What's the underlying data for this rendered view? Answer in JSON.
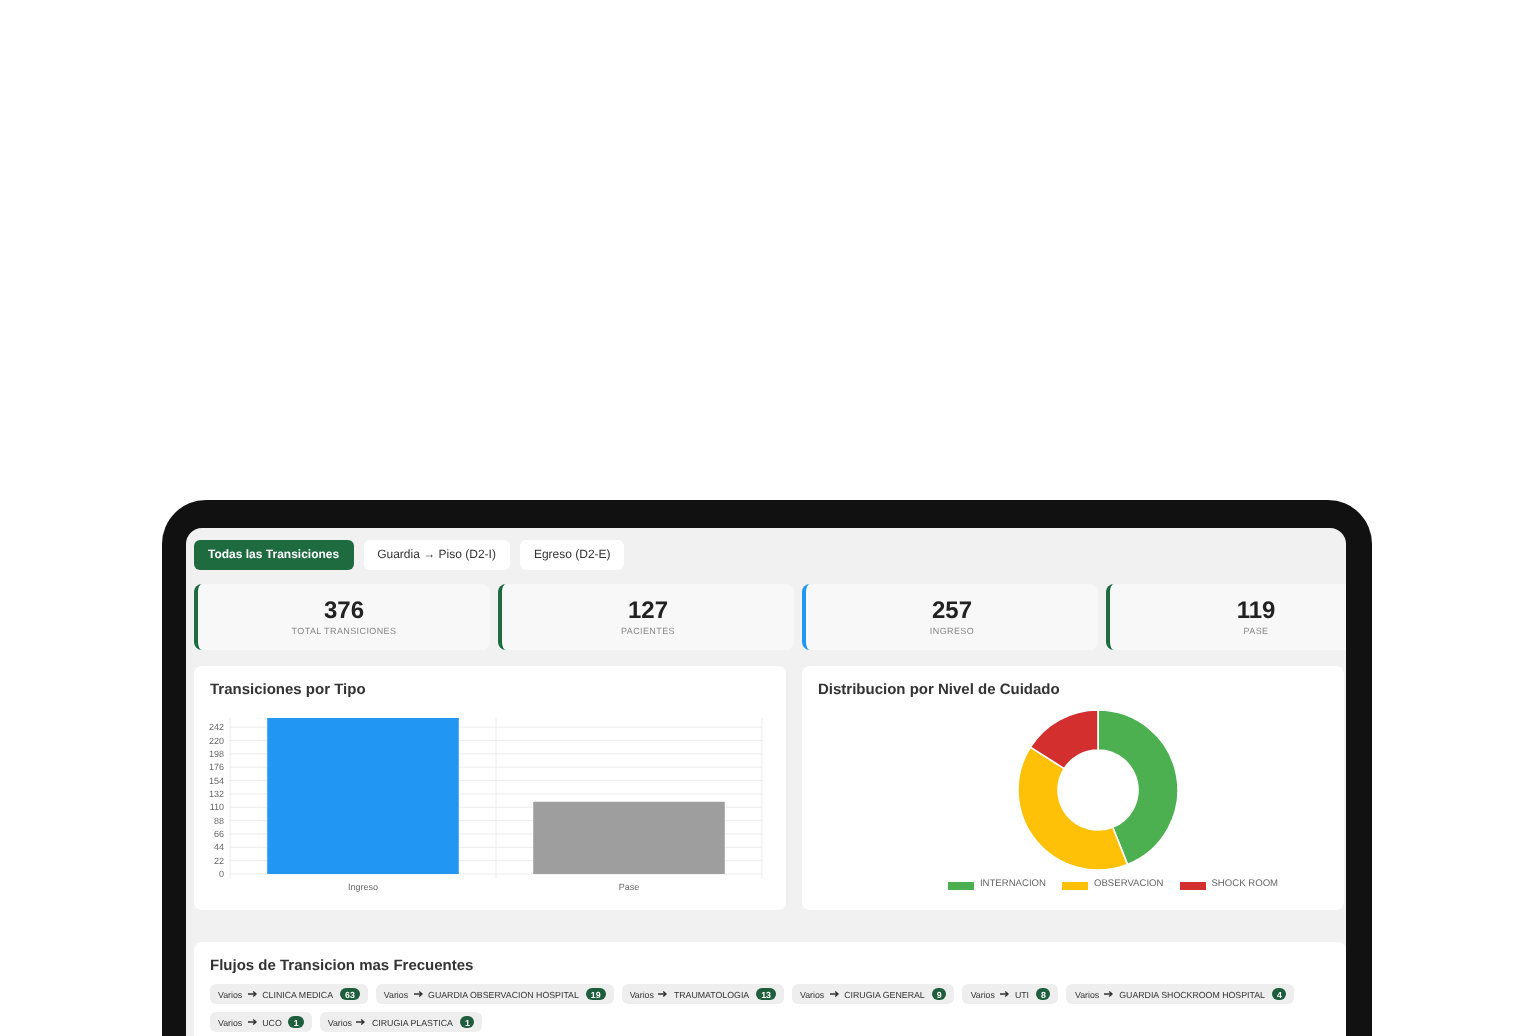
{
  "tabs": [
    {
      "label": "Todas las Transiciones",
      "selected": true
    },
    {
      "label": "Guardia → Piso (D2-I)",
      "selected": false
    },
    {
      "label": "Egreso (D2-E)",
      "selected": false
    }
  ],
  "stats": [
    {
      "value": "376",
      "label": "TOTAL TRANSICIONES",
      "color": "#1e6b40"
    },
    {
      "value": "127",
      "label": "PACIENTES",
      "color": "#1e6b40"
    },
    {
      "value": "257",
      "label": "INGRESO",
      "color": "#2196f3"
    },
    {
      "value": "119",
      "label": "PASE",
      "color": "#1e6b40"
    }
  ],
  "bar_panel": {
    "title": "Transiciones por Tipo",
    "chart_data": {
      "type": "bar",
      "categories": [
        "Ingreso",
        "Pase"
      ],
      "values": [
        257,
        119
      ],
      "colors": [
        "#2196f3",
        "#9e9e9e"
      ],
      "ylim": [
        0,
        257
      ],
      "grid": true,
      "yticks": [
        0,
        22,
        44,
        66,
        88,
        110,
        132,
        154,
        176,
        198,
        220,
        242
      ]
    }
  },
  "donut_panel": {
    "title": "Distribucion por Nivel de Cuidado",
    "legend": [
      {
        "label": "INTERNACION",
        "color": "#4caf50"
      },
      {
        "label": "OBSERVACION",
        "color": "#ffc107"
      },
      {
        "label": "SHOCK ROOM",
        "color": "#d32f2f"
      }
    ]
  },
  "flows_panel": {
    "title": "Flujos de Transicion mas Frecuentes",
    "flows": [
      {
        "from": "Varios",
        "to": "CLINICA MEDICA",
        "count": "63"
      },
      {
        "from": "Varios",
        "to": "GUARDIA OBSERVACION HOSPITAL",
        "count": "19"
      },
      {
        "from": "Varios",
        "to": "TRAUMATOLOGIA",
        "count": "13"
      },
      {
        "from": "Varios",
        "to": "CIRUGIA GENERAL",
        "count": "9"
      },
      {
        "from": "Varios",
        "to": "UTI",
        "count": "8"
      },
      {
        "from": "Varios",
        "to": "GUARDIA SHOCKROOM HOSPITAL",
        "count": "4"
      },
      {
        "from": "Varios",
        "to": "UCO",
        "count": "1"
      },
      {
        "from": "Varios",
        "to": "CIRUGIA PLASTICA",
        "count": "1"
      }
    ]
  }
}
